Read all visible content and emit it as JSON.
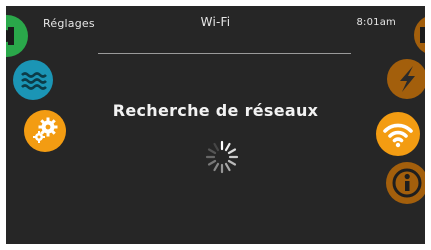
{
  "header": {
    "section_label": "Réglages",
    "title": "Wi-Fi",
    "time": "8:01am"
  },
  "main": {
    "status_message": "Recherche de réseaux"
  },
  "colors": {
    "background": "#262626",
    "green": "#2aa84a",
    "water_teal": "#1b95b5",
    "orange": "#f39c12",
    "dim_orange": "#a35f0c"
  },
  "icons": {
    "left": [
      "back-icon",
      "water-icon",
      "settings-icon"
    ],
    "right": [
      "exit-icon",
      "lightning-icon",
      "wifi-icon",
      "info-icon"
    ]
  }
}
